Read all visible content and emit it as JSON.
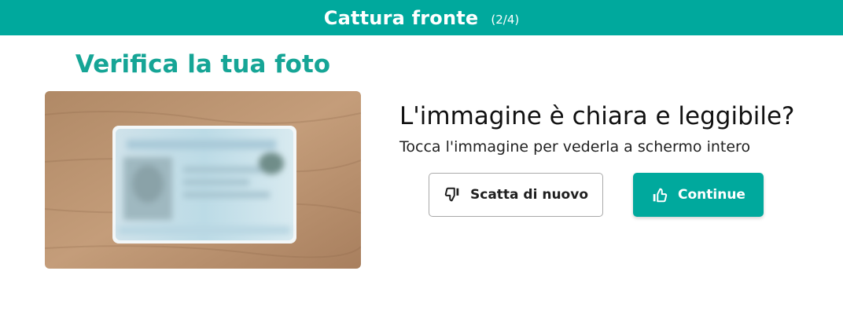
{
  "header": {
    "title": "Cattura fronte",
    "step": "(2/4)",
    "color": "#00a99d"
  },
  "main": {
    "title": "Verifica la tua foto",
    "title_color": "#16a596",
    "photo": {
      "icon": "id-card-photo"
    },
    "question": "L'immagine è chiara e leggibile?",
    "hint": "Tocca l'immagine per vederla a schermo intero",
    "retry_button": {
      "label": "Scatta di nuovo",
      "icon": "thumbs-down-icon"
    },
    "continue_button": {
      "label": "Continue",
      "icon": "thumbs-up-icon",
      "color": "#00a99d"
    }
  }
}
